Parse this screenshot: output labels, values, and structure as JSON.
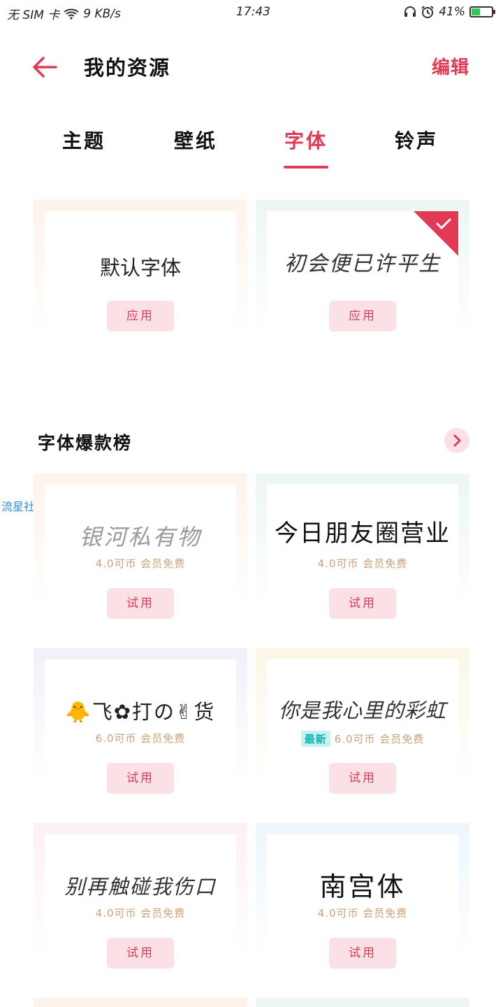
{
  "status_bar": {
    "sim": "无 SIM 卡",
    "speed": "9 KB/s",
    "time": "17:43",
    "battery": "41%",
    "battery_level": 0.41,
    "icons": [
      "wifi-icon",
      "headphones-icon",
      "alarm-icon",
      "battery-charging-icon"
    ]
  },
  "header": {
    "title": "我的资源",
    "edit": "编辑",
    "back_icon": "back-arrow-icon"
  },
  "tabs": [
    "主题",
    "壁纸",
    "字体",
    "铃声"
  ],
  "active_tab": 2,
  "owned_fonts": [
    {
      "preview": "默认字体",
      "button": "应用",
      "selected": false
    },
    {
      "preview": "初会便已许平生",
      "button": "应用",
      "selected": true
    }
  ],
  "section": {
    "title": "字体爆款榜",
    "more_icon": "chevron-right-icon"
  },
  "watermark": "流星社区",
  "ranking_fonts": [
    {
      "preview": "银河私有物",
      "price": "4.0可币 会员免费",
      "badge": "",
      "button": "试用"
    },
    {
      "preview": "今日朋友圈营业",
      "price": "4.0可币 会员免费",
      "badge": "",
      "button": "试用"
    },
    {
      "preview": "🐥飞✿打の✌货",
      "price": "6.0可币 会员免费",
      "badge": "",
      "button": "试用"
    },
    {
      "preview": "你是我心里的彩虹",
      "price": "6.0可币 会员免费",
      "badge": "最新",
      "button": "试用"
    },
    {
      "preview": "别再触碰我伤口",
      "price": "4.0可币 会员免费",
      "badge": "",
      "button": "试用"
    },
    {
      "preview": "南宫体",
      "price": "4.0可币 会员免费",
      "badge": "",
      "button": "试用"
    }
  ],
  "colors": {
    "accent": "#e23a55",
    "button_bg": "#fbe1e5",
    "price": "#c9a27a",
    "badge_bg": "#c6f3f1",
    "badge_text": "#12b3b0"
  }
}
